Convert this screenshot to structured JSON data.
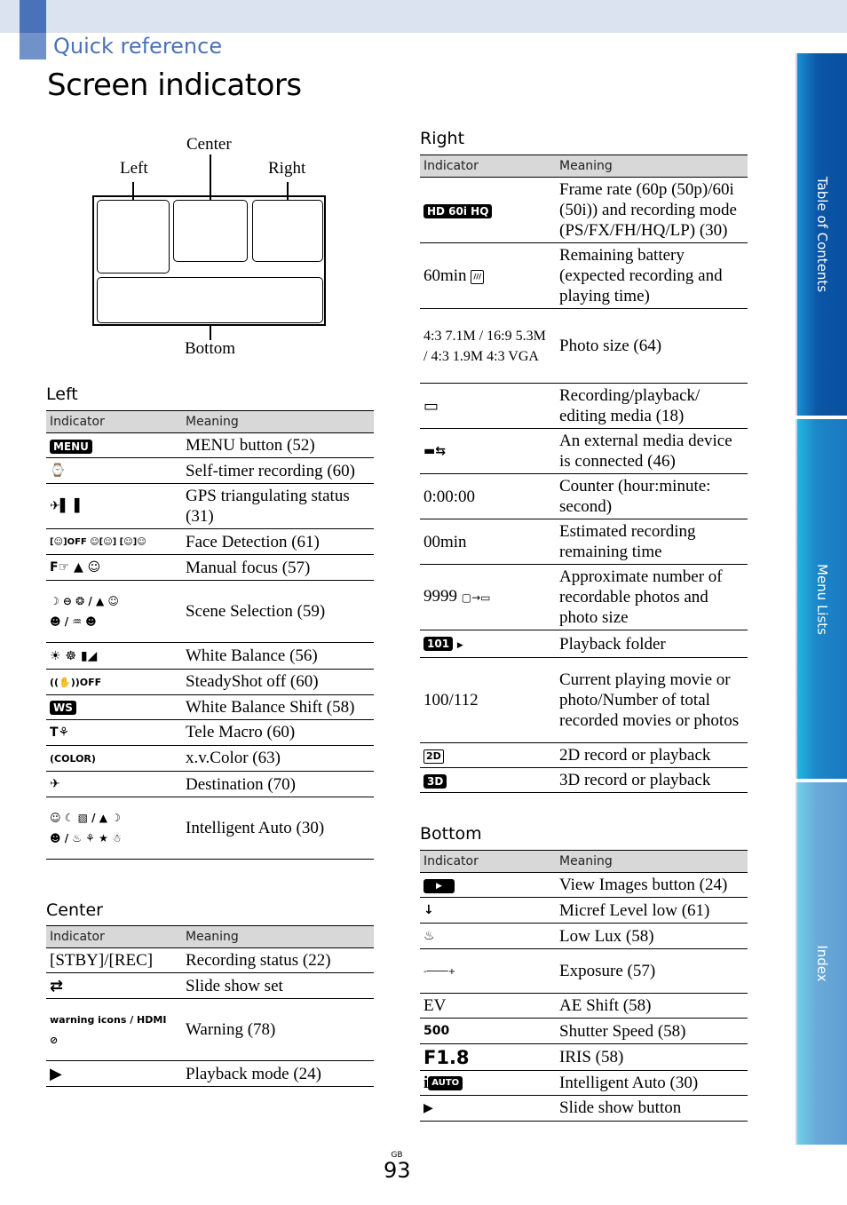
{
  "header": {
    "section": "Quick reference",
    "title": "Screen indicators"
  },
  "diagram": {
    "left": "Left",
    "center": "Center",
    "right": "Right",
    "bottom": "Bottom"
  },
  "columns": {
    "indicator": "Indicator",
    "meaning": "Meaning"
  },
  "left": {
    "title": "Left",
    "rows": [
      {
        "indicator": "MENU",
        "icon": "menu-badge",
        "meaning": "MENU button (52)"
      },
      {
        "indicator": "⌚",
        "icon": "self-timer-icon",
        "meaning": "Self-timer recording (60)"
      },
      {
        "indicator": "✈▌▐",
        "icon": "gps-signal-icon",
        "meaning": "GPS triangulating status (31)"
      },
      {
        "indicator": "[☺]OFF  ☺[☺]  [☺]☺",
        "icon": "face-detection-icons",
        "meaning": "Face Detection (61)"
      },
      {
        "indicator": "F☞  ▲  ☺",
        "icon": "manual-focus-icons",
        "meaning": "Manual focus (57)"
      },
      {
        "indicator": "☽ ⊖ ❂ / ▲ ☺ ☻ / ♒ ☻",
        "icon": "scene-selection-icons",
        "meaning": "Scene Selection (59)"
      },
      {
        "indicator": "☀ ☸ ▮◢",
        "icon": "white-balance-icons",
        "meaning": "White Balance (56)"
      },
      {
        "indicator": "((✋))OFF",
        "icon": "steadyshot-off-icon",
        "meaning": "SteadyShot off (60)"
      },
      {
        "indicator": "WS",
        "icon": "wb-shift-icon",
        "meaning": "White Balance Shift (58)"
      },
      {
        "indicator": "T⚘",
        "icon": "tele-macro-icon",
        "meaning": "Tele Macro (60)"
      },
      {
        "indicator": "(COLOR)",
        "icon": "xvcolor-icon",
        "meaning": "x.v.Color (63)"
      },
      {
        "indicator": "✈",
        "icon": "destination-icon",
        "meaning": "Destination (70)"
      },
      {
        "indicator": "☺ ☾ ▧ / ▲ ☽ ☻ / ♨ ⚘ ★ ☃",
        "icon": "intelligent-auto-icons",
        "meaning": "Intelligent Auto (30)"
      }
    ]
  },
  "center": {
    "title": "Center",
    "rows": [
      {
        "indicator": "[STBY]/[REC]",
        "meaning": "Recording status (22)"
      },
      {
        "indicator": "⇄",
        "icon": "slide-show-set-icon",
        "meaning": "Slide show set"
      },
      {
        "indicator": "warning icons / HDMI ⊘",
        "icon": "warning-icons",
        "meaning": "Warning (78)"
      },
      {
        "indicator": "▶",
        "icon": "playback-icon",
        "meaning": "Playback mode (24)"
      }
    ]
  },
  "right": {
    "title": "Right",
    "rows": [
      {
        "indicator": "HD 60i HQ",
        "meaning": "Frame rate (60p (50p)/60i (50i)) and recording mode (PS/FX/FH/HQ/LP) (30)"
      },
      {
        "indicator": "60min",
        "icon": "battery-icon",
        "meaning": "Remaining battery (expected recording and playing time)"
      },
      {
        "indicator": "4:3 7.1M / 16:9 5.3M / 4:3 1.9M  4:3 VGA",
        "meaning": "Photo size (64)"
      },
      {
        "indicator": "▭",
        "icon": "memory-card-icon",
        "meaning": "Recording/playback/ editing media (18)"
      },
      {
        "indicator": "▬⇆",
        "icon": "usb-device-icon",
        "meaning": "An external media device is connected (46)"
      },
      {
        "indicator": "0:00:00",
        "meaning": "Counter (hour:minute: second)"
      },
      {
        "indicator": "00min",
        "meaning": "Estimated recording remaining time"
      },
      {
        "indicator": "9999",
        "icon": "photo-to-card-icon",
        "meaning": "Approximate number of recordable photos and photo size"
      },
      {
        "indicator": "101",
        "icon": "folder-icon",
        "meaning": "Playback folder"
      },
      {
        "indicator": "100/112",
        "meaning": "Current playing movie or photo/Number of total recorded movies or photos"
      },
      {
        "indicator": "2D",
        "meaning": "2D record or playback"
      },
      {
        "indicator": "3D",
        "meaning": "3D record or playback"
      }
    ]
  },
  "bottom": {
    "title": "Bottom",
    "rows": [
      {
        "indicator": "▶",
        "icon": "view-images-icon",
        "meaning": "View Images button (24)"
      },
      {
        "indicator": "↓",
        "icon": "mic-level-icon",
        "meaning": "Micref Level low (61)"
      },
      {
        "indicator": "♨",
        "icon": "low-lux-icon",
        "meaning": "Low Lux (58)"
      },
      {
        "indicator": "-────+",
        "icon": "exposure-bar-icon",
        "meaning": "Exposure (57)"
      },
      {
        "indicator": "EV",
        "meaning": "AE Shift (58)"
      },
      {
        "indicator": "500",
        "meaning": "Shutter Speed (58)"
      },
      {
        "indicator": "F1.8",
        "meaning": "IRIS (58)"
      },
      {
        "indicator": "AUTO",
        "icon": "intelligent-auto-icon",
        "meaning": "Intelligent Auto (30)"
      },
      {
        "indicator": "▶",
        "icon": "slide-show-icon",
        "meaning": "Slide show button"
      }
    ]
  },
  "tabs": [
    {
      "label": "Table of Contents"
    },
    {
      "label": "Menu Lists"
    },
    {
      "label": "Index"
    }
  ],
  "footer": {
    "region": "GB",
    "page": "93"
  },
  "colors": {
    "accent": "#4a72b8",
    "header_band": "#dce3f0",
    "table_header": "#d8d8d8"
  }
}
